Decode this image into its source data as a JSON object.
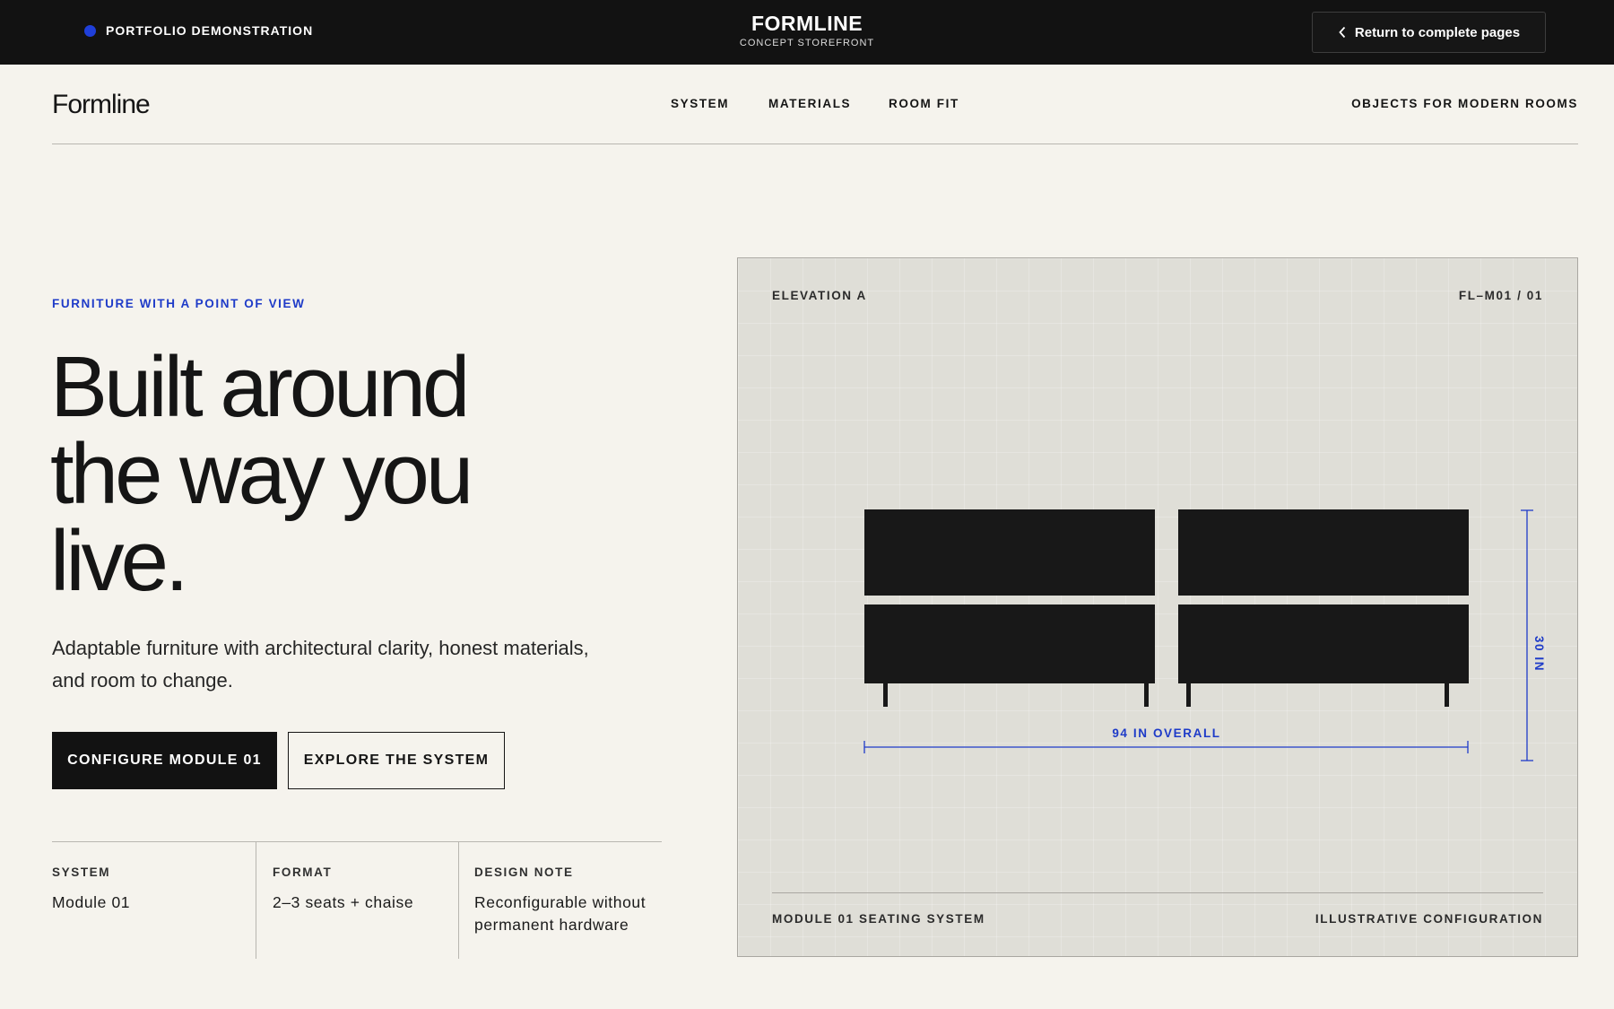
{
  "topbar": {
    "demo_label": "PORTFOLIO DEMONSTRATION",
    "brand_title": "FORMLINE",
    "brand_subtitle": "CONCEPT STOREFRONT",
    "return_label": "Return to complete pages"
  },
  "site": {
    "logo": "Formline",
    "nav": [
      "SYSTEM",
      "MATERIALS",
      "ROOM FIT"
    ],
    "tagline": "OBJECTS FOR MODERN ROOMS"
  },
  "hero": {
    "eyebrow": "FURNITURE WITH A POINT OF VIEW",
    "headline": [
      "Built around",
      "the way you",
      "live."
    ],
    "lead": "Adaptable furniture with architectural clarity, honest materials, and room to change.",
    "primary_cta": "CONFIGURE MODULE 01",
    "secondary_cta": "EXPLORE THE SYSTEM",
    "specs": [
      {
        "label": "SYSTEM",
        "value": "Module 01"
      },
      {
        "label": "FORMAT",
        "value": "2–3 seats + chaise"
      },
      {
        "label": "DESIGN NOTE",
        "value": "Reconfigurable without permanent hardware"
      }
    ]
  },
  "elevation": {
    "title": "ELEVATION A",
    "code": "FL–M01 / 01",
    "width_label": "94 IN OVERALL",
    "height_label": "30 IN",
    "footer_left": "MODULE 01 SEATING SYSTEM",
    "footer_right": "ILLUSTRATIVE CONFIGURATION"
  },
  "colors": {
    "accent": "#1e3bc8",
    "ink": "#151515",
    "paper": "#f5f3ed",
    "panel": "#dfded7",
    "topbar": "#121212"
  },
  "icons": {
    "demo_indicator": "blue-dot",
    "return": "chevron-left-icon"
  }
}
